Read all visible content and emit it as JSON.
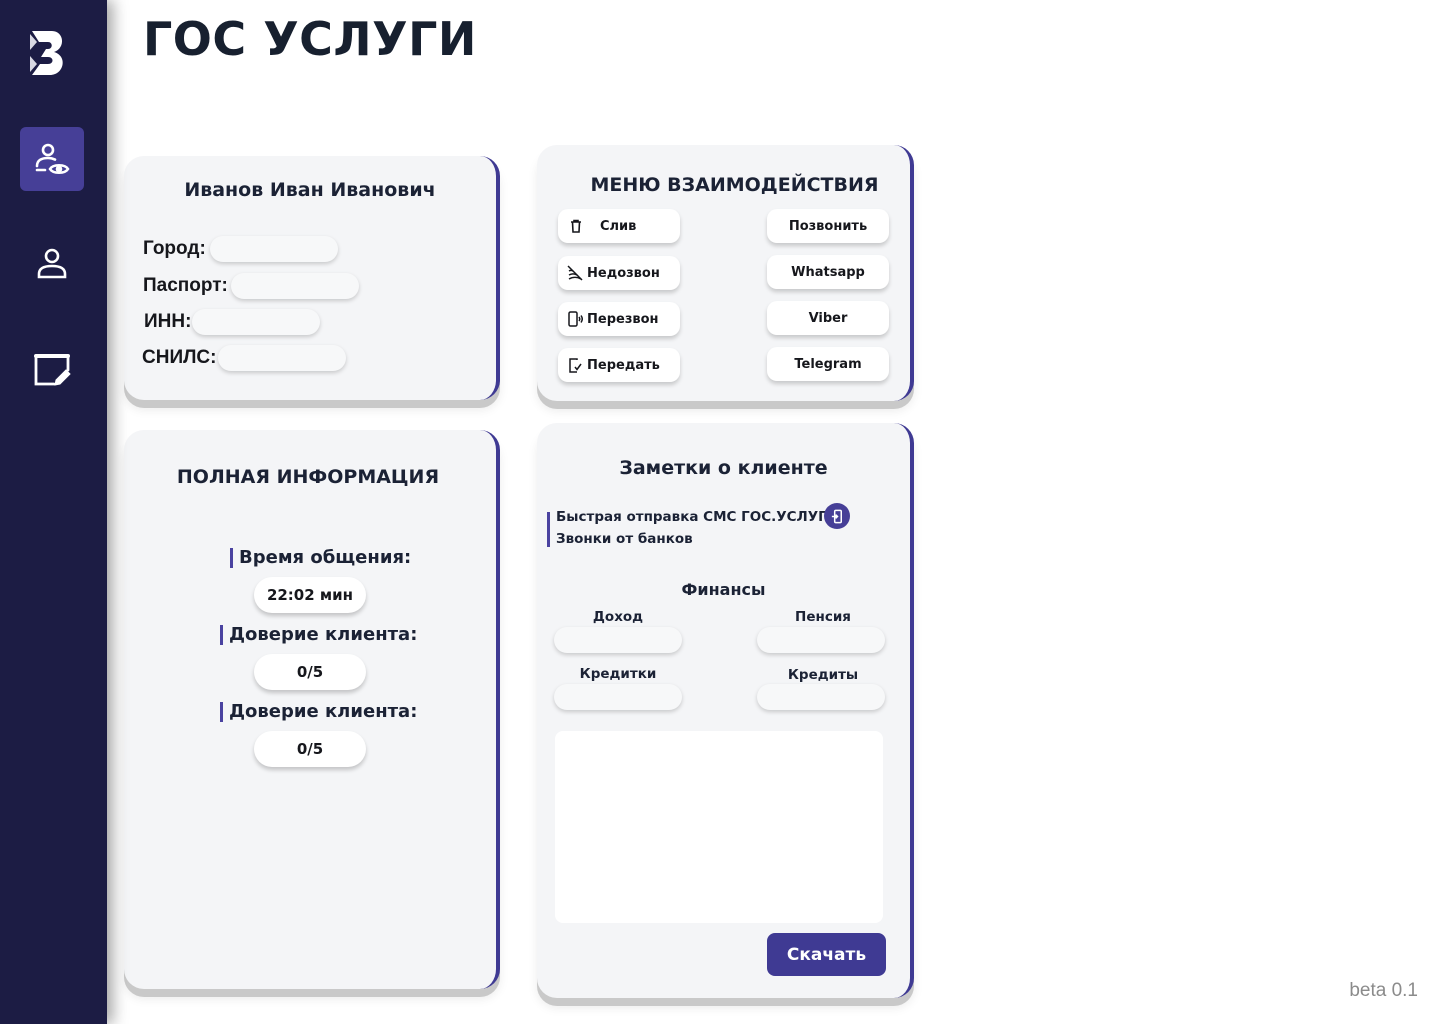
{
  "page": {
    "title": "ГОС УСЛУГИ",
    "version": "beta 0.1"
  },
  "colors": {
    "sidebar": "#1c1c44",
    "accent": "#463f97",
    "card": "#f4f5f7"
  },
  "sidebar": {
    "items": [
      {
        "icon": "user-eye-icon",
        "active": true
      },
      {
        "icon": "user-icon",
        "active": false
      },
      {
        "icon": "edit-note-icon",
        "active": false
      }
    ]
  },
  "client": {
    "name": "Иванов Иван Иванович",
    "fields": [
      {
        "label": "Город:",
        "value": ""
      },
      {
        "label": "Паспорт:",
        "value": ""
      },
      {
        "label": "ИНН:",
        "value": ""
      },
      {
        "label": "СНИЛС:",
        "value": ""
      }
    ]
  },
  "menu": {
    "title": "МЕНЮ ВЗАИМОДЕЙСТВИЯ",
    "left_buttons": [
      {
        "label": "Слив",
        "icon": "trash-icon"
      },
      {
        "label": "Недозвон",
        "icon": "no-signal-icon"
      },
      {
        "label": "Перезвон",
        "icon": "phone-ring-icon"
      },
      {
        "label": "Передать",
        "icon": "phone-transfer-icon"
      }
    ],
    "right_buttons": [
      {
        "label": "Позвонить"
      },
      {
        "label": "Whatsapp"
      },
      {
        "label": "Viber"
      },
      {
        "label": "Telegram"
      }
    ]
  },
  "full_info": {
    "title": "ПОЛНАЯ ИНФОРМАЦИЯ",
    "items": [
      {
        "label": "Время общения:",
        "value": "22:02 мин"
      },
      {
        "label": "Доверие клиента:",
        "value": "0/5"
      },
      {
        "label": "Доверие клиента:",
        "value": "0/5"
      }
    ]
  },
  "notes": {
    "title": "Заметки о клиенте",
    "lines": [
      "Быстрая отправка СМС ГОС.УСЛУГИ",
      "Звонки от банков"
    ],
    "finance_title": "Финансы",
    "finance_fields": [
      {
        "label": "Доход",
        "value": ""
      },
      {
        "label": "Пенсия",
        "value": ""
      },
      {
        "label": "Кредитки",
        "value": ""
      },
      {
        "label": "Кредиты",
        "value": ""
      }
    ],
    "notes_text": "",
    "download_label": "Скачать"
  }
}
